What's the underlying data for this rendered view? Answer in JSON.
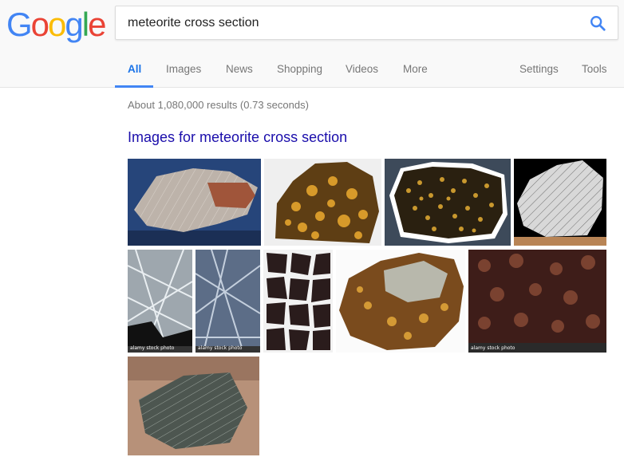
{
  "logo": {
    "letters": [
      "G",
      "o",
      "o",
      "g",
      "l",
      "e"
    ],
    "colors": [
      "#4285f4",
      "#ea4335",
      "#fbbc05",
      "#4285f4",
      "#34a853",
      "#ea4335"
    ]
  },
  "search": {
    "query": "meteorite cross section",
    "icon": "search-icon"
  },
  "tabs": {
    "all": "All",
    "images": "Images",
    "news": "News",
    "shopping": "Shopping",
    "videos": "Videos",
    "more": "More",
    "settings": "Settings",
    "tools": "Tools"
  },
  "results": {
    "stats": "About 1,080,000 results (0.73 seconds)",
    "images_heading": "Images for meteorite cross section",
    "watermark": "alamy stock photo"
  },
  "colors": {
    "accent": "#4285f4",
    "link": "#1a0dab",
    "muted": "#777777"
  }
}
